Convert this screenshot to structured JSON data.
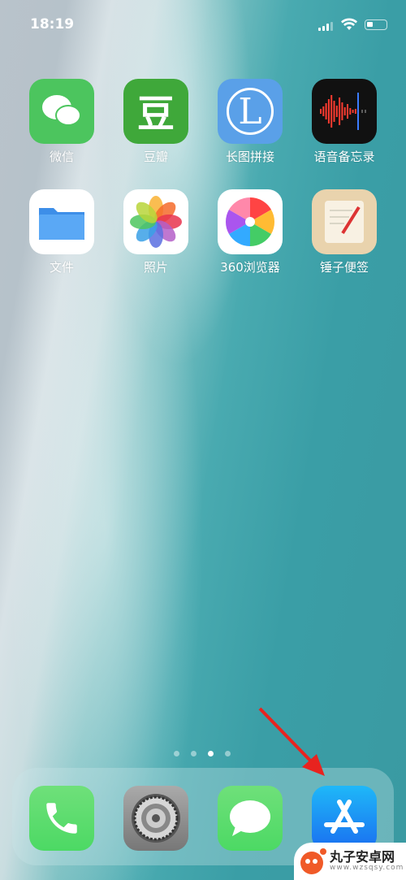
{
  "status": {
    "time": "18:19",
    "battery_level": 0.3
  },
  "apps": [
    {
      "label": "微信",
      "icon": "wechat-icon",
      "color": "#4cc55e"
    },
    {
      "label": "豆瓣",
      "icon": "douban-icon",
      "glyph": "豆",
      "color": "#3fa83a"
    },
    {
      "label": "长图拼接",
      "icon": "long-image-icon",
      "glyph": "L",
      "color": "#5aa0e8"
    },
    {
      "label": "语音备忘录",
      "icon": "voice-memos-icon",
      "color": "#111111"
    },
    {
      "label": "文件",
      "icon": "files-icon",
      "color": "#ffffff"
    },
    {
      "label": "照片",
      "icon": "photos-icon",
      "color": "#ffffff"
    },
    {
      "label": "360浏览器",
      "icon": "360-browser-icon",
      "color": "#ffffff"
    },
    {
      "label": "锤子便签",
      "icon": "smartisan-notes-icon",
      "color": "#e9d3ad"
    }
  ],
  "page_indicator": {
    "count": 4,
    "current": 3
  },
  "dock": [
    {
      "icon": "phone-icon",
      "color": "#4cd964"
    },
    {
      "icon": "settings-icon",
      "color": "#8e8e93"
    },
    {
      "icon": "messages-icon",
      "color": "#4cd964"
    },
    {
      "icon": "app-store-icon",
      "color": "#1a8cf0"
    }
  ],
  "watermark": {
    "title": "丸子安卓网",
    "url": "www.wzsqsy.com"
  }
}
